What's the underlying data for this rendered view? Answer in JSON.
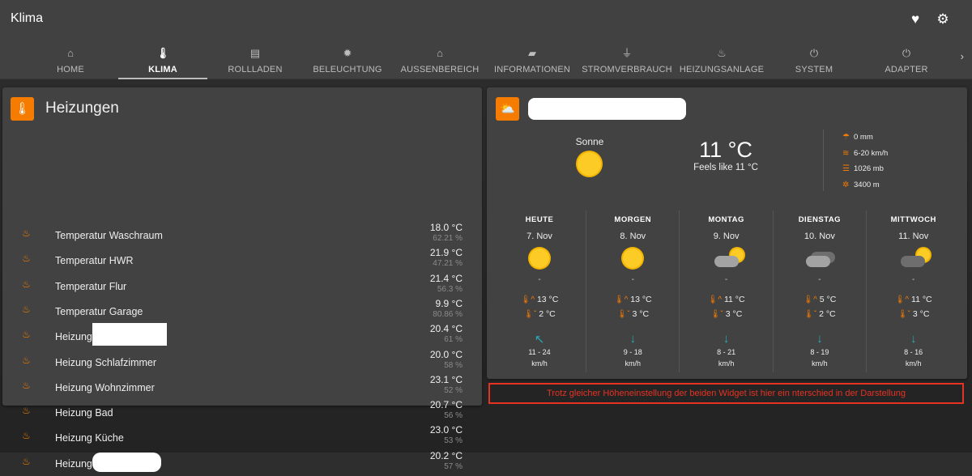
{
  "app": {
    "title": "Klima",
    "favorite_icon": "heart-icon",
    "settings_icon": "gear-icon"
  },
  "tabs": [
    {
      "label": "HOME",
      "icon": "home-icon",
      "glyph": "⌂"
    },
    {
      "label": "KLIMA",
      "icon": "thermometer-icon",
      "glyph": "🌡",
      "active": true
    },
    {
      "label": "ROLLLADEN",
      "icon": "blinds-icon",
      "glyph": "▤"
    },
    {
      "label": "BELEUCHTUNG",
      "icon": "lightbulb-icon",
      "glyph": "✹"
    },
    {
      "label": "AUSSENBEREICH",
      "icon": "house-icon",
      "glyph": "⌂"
    },
    {
      "label": "INFORMATIONEN",
      "icon": "folder-info-icon",
      "glyph": "▰"
    },
    {
      "label": "STROMVERBRAUCH",
      "icon": "plug-icon",
      "glyph": "⏚"
    },
    {
      "label": "HEIZUNGSANLAGE",
      "icon": "radiator-icon",
      "glyph": "♨"
    },
    {
      "label": "SYSTEM",
      "icon": "power-icon",
      "glyph": "⏻"
    },
    {
      "label": "ADAPTER",
      "icon": "power-icon",
      "glyph": "⏻"
    }
  ],
  "heating": {
    "title": "Heizungen",
    "rows": [
      {
        "name": "Temperatur Waschraum",
        "temp": "18.0 °C",
        "hum": "62.21 %"
      },
      {
        "name": "Temperatur HWR",
        "temp": "21.9 °C",
        "hum": "47.21 %"
      },
      {
        "name": "Temperatur Flur",
        "temp": "21.4 °C",
        "hum": "56.3 %"
      },
      {
        "name": "Temperatur Garage",
        "temp": "9.9 °C",
        "hum": "80.86 %"
      },
      {
        "name": "Heizung",
        "temp": "20.4 °C",
        "hum": "61 %",
        "redacted": "box"
      },
      {
        "name": "Heizung Schlafzimmer",
        "temp": "20.0 °C",
        "hum": "58 %"
      },
      {
        "name": "Heizung Wohnzimmer",
        "temp": "23.1 °C",
        "hum": "52 %"
      },
      {
        "name": "Heizung Bad",
        "temp": "20.7 °C",
        "hum": "56 %"
      },
      {
        "name": "Heizung Küche",
        "temp": "23.0 °C",
        "hum": "53 %"
      },
      {
        "name": "Heizung",
        "temp": "20.2 °C",
        "hum": "57 %",
        "redacted": "round"
      }
    ]
  },
  "weather": {
    "condition": "Sonne",
    "temp": "11 °C",
    "feels": "Feels like 11 °C",
    "details": [
      {
        "icon": "umbrella-icon",
        "glyph": "☂",
        "value": "0 mm"
      },
      {
        "icon": "wind-icon",
        "glyph": "≋",
        "value": "6-20 km/h"
      },
      {
        "icon": "pressure-icon",
        "glyph": "☰",
        "value": "1026 mb"
      },
      {
        "icon": "visibility-icon",
        "glyph": "✲",
        "value": "3400 m"
      }
    ],
    "forecast": [
      {
        "day": "HEUTE",
        "date": "7. Nov",
        "icon": "sun",
        "precip": "-",
        "high": "13 °C",
        "low": "2 °C",
        "wind_dir": "↖",
        "wind": "11 - 24",
        "unit": "km/h"
      },
      {
        "day": "MORGEN",
        "date": "8. Nov",
        "icon": "sun",
        "precip": "-",
        "high": "13 °C",
        "low": "3 °C",
        "wind_dir": "↓",
        "wind": "9 - 18",
        "unit": "km/h"
      },
      {
        "day": "MONTAG",
        "date": "9. Nov",
        "icon": "partly-cloudy",
        "precip": "-",
        "high": "11 °C",
        "low": "3 °C",
        "wind_dir": "↓",
        "wind": "8 - 21",
        "unit": "km/h"
      },
      {
        "day": "DIENSTAG",
        "date": "10. Nov",
        "icon": "cloudy",
        "precip": "-",
        "high": "5 °C",
        "low": "2 °C",
        "wind_dir": "↓",
        "wind": "8 - 19",
        "unit": "km/h"
      },
      {
        "day": "MITTWOCH",
        "date": "11. Nov",
        "icon": "partly-cloudy-dark",
        "precip": "-",
        "high": "11 °C",
        "low": "3 °C",
        "wind_dir": "↓",
        "wind": "8 - 16",
        "unit": "km/h"
      }
    ]
  },
  "note": "Trotz gleicher Höheneinstellung der beiden Widget ist hier ein nterschied in der Darstellung",
  "colors": {
    "accent": "#f57c00",
    "note_red": "#e53222",
    "wind": "#2aa9b8",
    "sun": "#fdcb25"
  }
}
